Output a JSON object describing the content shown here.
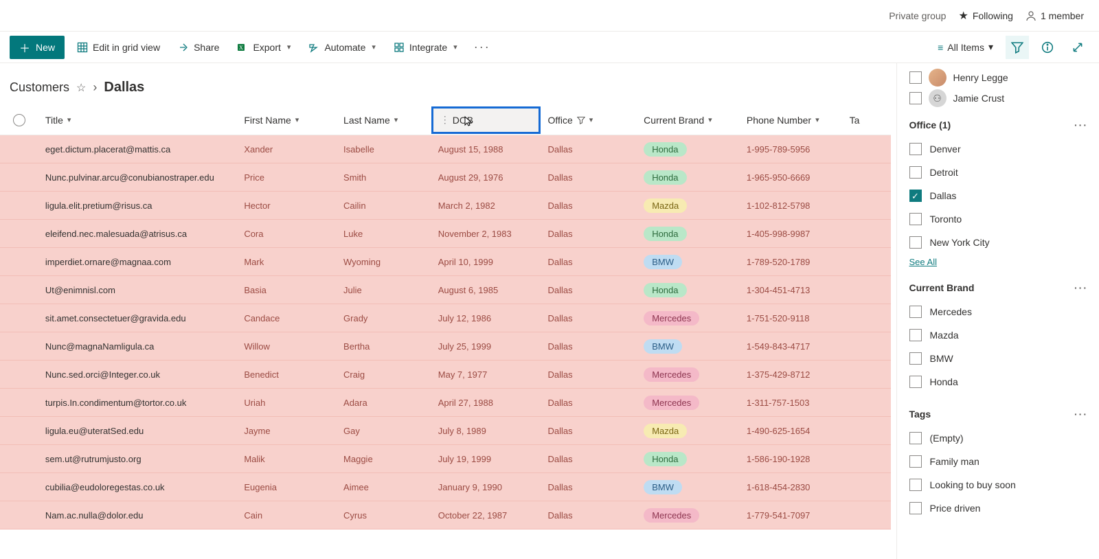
{
  "infobar": {
    "private_group": "Private group",
    "following": "Following",
    "members": "1 member"
  },
  "cmd": {
    "new": "New",
    "edit_grid": "Edit in grid view",
    "share": "Share",
    "export": "Export",
    "automate": "Automate",
    "integrate": "Integrate",
    "view_name": "All Items"
  },
  "breadcrumb": {
    "list": "Customers",
    "view": "Dallas"
  },
  "columns": {
    "title": "Title",
    "first_name": "First Name",
    "last_name": "Last Name",
    "dob": "DOB",
    "office": "Office",
    "current_brand": "Current Brand",
    "phone": "Phone Number",
    "tags": "Ta"
  },
  "rows": [
    {
      "title": "eget.dictum.placerat@mattis.ca",
      "first": "Xander",
      "last": "Isabelle",
      "dob": "August 15, 1988",
      "office": "Dallas",
      "brand": "Honda",
      "phone": "1-995-789-5956"
    },
    {
      "title": "Nunc.pulvinar.arcu@conubianostraper.edu",
      "first": "Price",
      "last": "Smith",
      "dob": "August 29, 1976",
      "office": "Dallas",
      "brand": "Honda",
      "phone": "1-965-950-6669"
    },
    {
      "title": "ligula.elit.pretium@risus.ca",
      "first": "Hector",
      "last": "Cailin",
      "dob": "March 2, 1982",
      "office": "Dallas",
      "brand": "Mazda",
      "phone": "1-102-812-5798"
    },
    {
      "title": "eleifend.nec.malesuada@atrisus.ca",
      "first": "Cora",
      "last": "Luke",
      "dob": "November 2, 1983",
      "office": "Dallas",
      "brand": "Honda",
      "phone": "1-405-998-9987"
    },
    {
      "title": "imperdiet.ornare@magnaa.com",
      "first": "Mark",
      "last": "Wyoming",
      "dob": "April 10, 1999",
      "office": "Dallas",
      "brand": "BMW",
      "phone": "1-789-520-1789"
    },
    {
      "title": "Ut@enimnisl.com",
      "first": "Basia",
      "last": "Julie",
      "dob": "August 6, 1985",
      "office": "Dallas",
      "brand": "Honda",
      "phone": "1-304-451-4713"
    },
    {
      "title": "sit.amet.consectetuer@gravida.edu",
      "first": "Candace",
      "last": "Grady",
      "dob": "July 12, 1986",
      "office": "Dallas",
      "brand": "Mercedes",
      "phone": "1-751-520-9118"
    },
    {
      "title": "Nunc@magnaNamligula.ca",
      "first": "Willow",
      "last": "Bertha",
      "dob": "July 25, 1999",
      "office": "Dallas",
      "brand": "BMW",
      "phone": "1-549-843-4717"
    },
    {
      "title": "Nunc.sed.orci@Integer.co.uk",
      "first": "Benedict",
      "last": "Craig",
      "dob": "May 7, 1977",
      "office": "Dallas",
      "brand": "Mercedes",
      "phone": "1-375-429-8712"
    },
    {
      "title": "turpis.In.condimentum@tortor.co.uk",
      "first": "Uriah",
      "last": "Adara",
      "dob": "April 27, 1988",
      "office": "Dallas",
      "brand": "Mercedes",
      "phone": "1-311-757-1503"
    },
    {
      "title": "ligula.eu@uteratSed.edu",
      "first": "Jayme",
      "last": "Gay",
      "dob": "July 8, 1989",
      "office": "Dallas",
      "brand": "Mazda",
      "phone": "1-490-625-1654"
    },
    {
      "title": "sem.ut@rutrumjusto.org",
      "first": "Malik",
      "last": "Maggie",
      "dob": "July 19, 1999",
      "office": "Dallas",
      "brand": "Honda",
      "phone": "1-586-190-1928"
    },
    {
      "title": "cubilia@eudoloregestas.co.uk",
      "first": "Eugenia",
      "last": "Aimee",
      "dob": "January 9, 1990",
      "office": "Dallas",
      "brand": "BMW",
      "phone": "1-618-454-2830"
    },
    {
      "title": "Nam.ac.nulla@dolor.edu",
      "first": "Cain",
      "last": "Cyrus",
      "dob": "October 22, 1987",
      "office": "Dallas",
      "brand": "Mercedes",
      "phone": "1-779-541-7097"
    }
  ],
  "filter": {
    "people": [
      {
        "name": "Henry Legge",
        "photo": true
      },
      {
        "name": "Jamie Crust",
        "photo": false
      }
    ],
    "office_title": "Office (1)",
    "office_options": [
      {
        "label": "Denver",
        "checked": false
      },
      {
        "label": "Detroit",
        "checked": false
      },
      {
        "label": "Dallas",
        "checked": true
      },
      {
        "label": "Toronto",
        "checked": false
      },
      {
        "label": "New York City",
        "checked": false
      }
    ],
    "see_all": "See All",
    "brand_title": "Current Brand",
    "brand_options": [
      {
        "label": "Mercedes"
      },
      {
        "label": "Mazda"
      },
      {
        "label": "BMW"
      },
      {
        "label": "Honda"
      }
    ],
    "tags_title": "Tags",
    "tags_options": [
      {
        "label": "(Empty)"
      },
      {
        "label": "Family man"
      },
      {
        "label": "Looking to buy soon"
      },
      {
        "label": "Price driven"
      }
    ]
  }
}
